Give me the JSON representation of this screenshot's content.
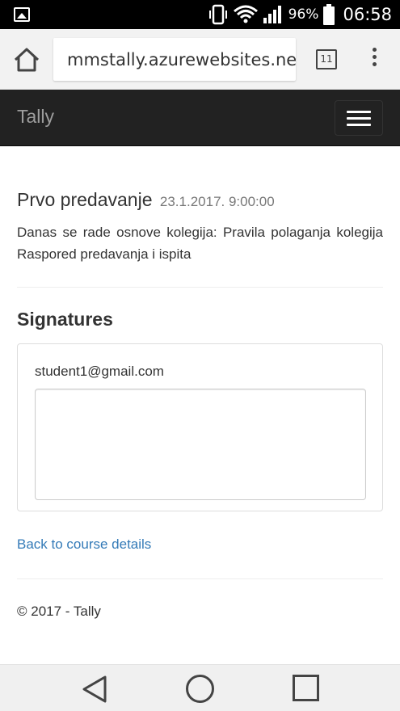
{
  "status_bar": {
    "battery_percent": "96%",
    "time": "06:58",
    "icons": [
      "image-notification-icon",
      "vibrate-icon",
      "wifi-icon",
      "signal-icon",
      "battery-icon"
    ]
  },
  "browser": {
    "url": "mmstally.azurewebsites.net",
    "tab_count": "11",
    "icons": [
      "home-icon",
      "tabs-icon",
      "more-vert-icon"
    ]
  },
  "navbar": {
    "brand": "Tally",
    "toggle_icon": "hamburger-menu-icon"
  },
  "lecture": {
    "title": "Prvo predavanje",
    "date": "23.1.2017. 9:00:00",
    "description": "Danas se rade osnove kolegija:  Pravila polaganja kolegija Raspored predavanja i ispita"
  },
  "signatures": {
    "heading": "Signatures",
    "email": "student1@gmail.com",
    "signature_value": ""
  },
  "links": {
    "back": "Back to course details"
  },
  "footer": {
    "text": "© 2017 - Tally"
  },
  "system_nav": {
    "icons": [
      "back-triangle-icon",
      "home-circle-icon",
      "recent-apps-square-icon"
    ]
  },
  "colors": {
    "navbar_bg": "#222222",
    "brand": "#9d9d9d",
    "link": "#337ab7",
    "muted": "#777777"
  }
}
